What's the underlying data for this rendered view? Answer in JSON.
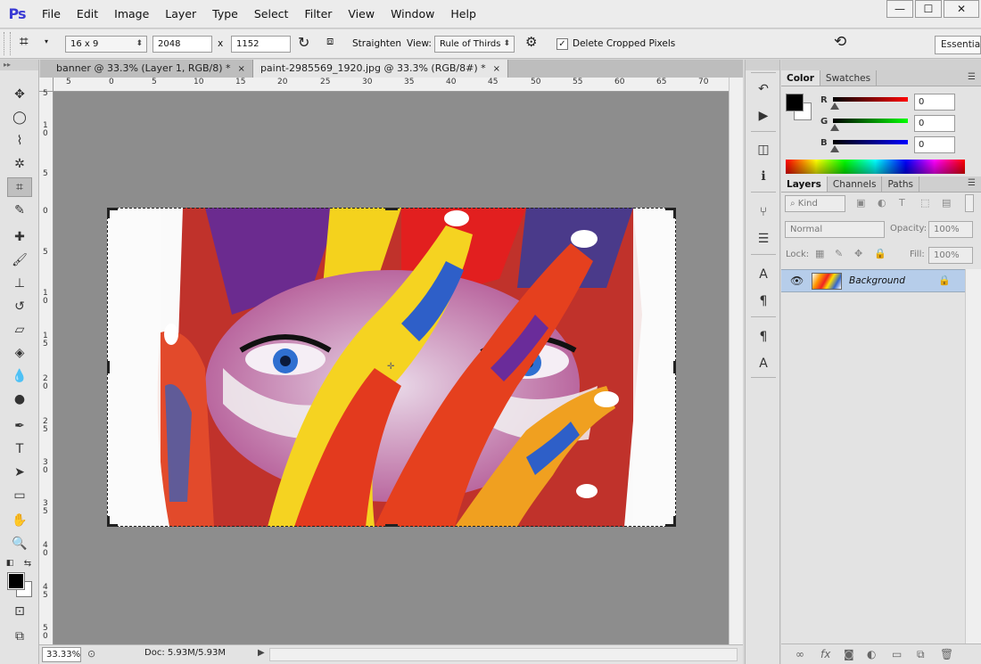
{
  "app": {
    "logo": "Ps",
    "menu": [
      "File",
      "Edit",
      "Image",
      "Layer",
      "Type",
      "Select",
      "Filter",
      "View",
      "Window",
      "Help"
    ],
    "window_controls": [
      "—",
      "☐",
      "✕"
    ]
  },
  "options_bar": {
    "ratio_preset": "16 x 9",
    "width_value": "2048",
    "times_sign": "x",
    "height_value": "1152",
    "straighten_label": "Straighten",
    "view_label": "View:",
    "view_value": "Rule of Thirds",
    "delete_cropped_label": "Delete Cropped Pixels",
    "delete_cropped_checked": "✓",
    "workspace": "Essentials"
  },
  "document_tabs": [
    {
      "label": "banner @ 33.3% (Layer 1, RGB/8) *",
      "close": "×"
    },
    {
      "label": "paint-2985569_1920.jpg @ 33.3% (RGB/8#) *",
      "close": "×"
    }
  ],
  "ruler": {
    "top_labels": [
      "5",
      "0",
      "5",
      "10",
      "15",
      "20",
      "25",
      "30",
      "35",
      "40",
      "45",
      "50",
      "55",
      "60",
      "65",
      "70"
    ],
    "left_labels": [
      "5",
      "1\n0",
      "5",
      "0",
      "5",
      "1\n0",
      "1\n5",
      "2\n0",
      "2\n5",
      "3\n0",
      "3\n5",
      "4\n0",
      "4\n5",
      "5\n0",
      "5\n5"
    ]
  },
  "status": {
    "zoom": "33.33%",
    "doc_info": "Doc: 5.93M/5.93M"
  },
  "color_panel": {
    "tabs": [
      "Color",
      "Swatches"
    ],
    "channels": [
      {
        "label": "R",
        "value": "0",
        "color": "#ff0000"
      },
      {
        "label": "G",
        "value": "0",
        "color": "#00ff00"
      },
      {
        "label": "B",
        "value": "0",
        "color": "#0000ff"
      }
    ],
    "foreground": "#000000",
    "background": "#ffffff"
  },
  "layers_panel": {
    "tabs": [
      "Layers",
      "Channels",
      "Paths"
    ],
    "kind_filter": "Kind",
    "blend_mode": "Normal",
    "opacity_label": "Opacity:",
    "opacity_value": "100%",
    "lock_label": "Lock:",
    "fill_label": "Fill:",
    "fill_value": "100%",
    "layers": [
      {
        "name": "Background",
        "visible": true,
        "locked": true
      }
    ]
  },
  "colors": {
    "canvas_bg": "#8d8d8d",
    "selected_layer": "#b6cdea",
    "logo": "#3b3bd4"
  }
}
